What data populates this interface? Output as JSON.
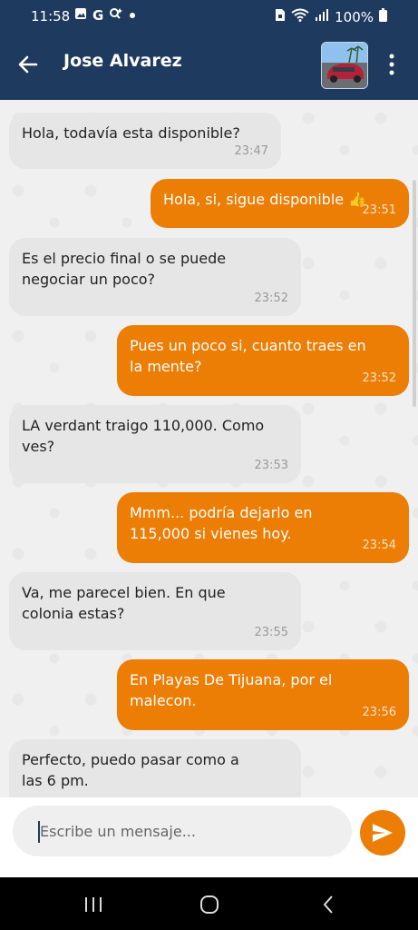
{
  "status_bar": {
    "time": "11:58",
    "battery": "100%",
    "left_icons": [
      "image-icon",
      "google-icon",
      "search-sparkle-icon",
      "dot-icon"
    ],
    "right_icons": [
      "lock-sim-icon",
      "wifi-icon",
      "signal-icon",
      "battery-icon"
    ]
  },
  "header": {
    "contact_name": "Jose Alvarez",
    "back_icon": "arrow-left-icon",
    "menu_icon": "more-vert-icon"
  },
  "colors": {
    "header_bg": "#1f3a5f",
    "outgoing_bubble": "#ec7d05",
    "incoming_bubble": "#e6e6e6"
  },
  "messages": [
    {
      "direction": "in",
      "text": "Hola, todavía esta disponible?",
      "time": "23:47"
    },
    {
      "direction": "out",
      "text": "Hola, si, sigue disponible 👍",
      "time": "23:51"
    },
    {
      "direction": "in",
      "text": "Es el precio final o se puede\nnegociar un poco?",
      "time": "23:52"
    },
    {
      "direction": "out",
      "text": "Pues un poco si, cuanto traes en\nla mente?",
      "time": "23:52"
    },
    {
      "direction": "in",
      "text": "LA verdant traigo 110,000. Como\nves?",
      "time": "23:53"
    },
    {
      "direction": "out",
      "text": "Mmm... podría dejarlo en\n115,000 si vienes hoy.",
      "time": "23:54"
    },
    {
      "direction": "in",
      "text": "Va, me parecel bien. En que\ncolonia estas?",
      "time": "23:55"
    },
    {
      "direction": "out",
      "text": "En Playas De Tijuana, por el\nmalecon.",
      "time": "23:56"
    },
    {
      "direction": "in",
      "text": "Perfecto, puedo pasar como a\nlas 6 pm.",
      "time": ""
    }
  ],
  "composer": {
    "placeholder": "Escribe un mensaje...",
    "send_icon": "send-icon"
  },
  "nav_bar": {
    "buttons": [
      "recents-icon",
      "home-icon",
      "back-icon"
    ]
  }
}
